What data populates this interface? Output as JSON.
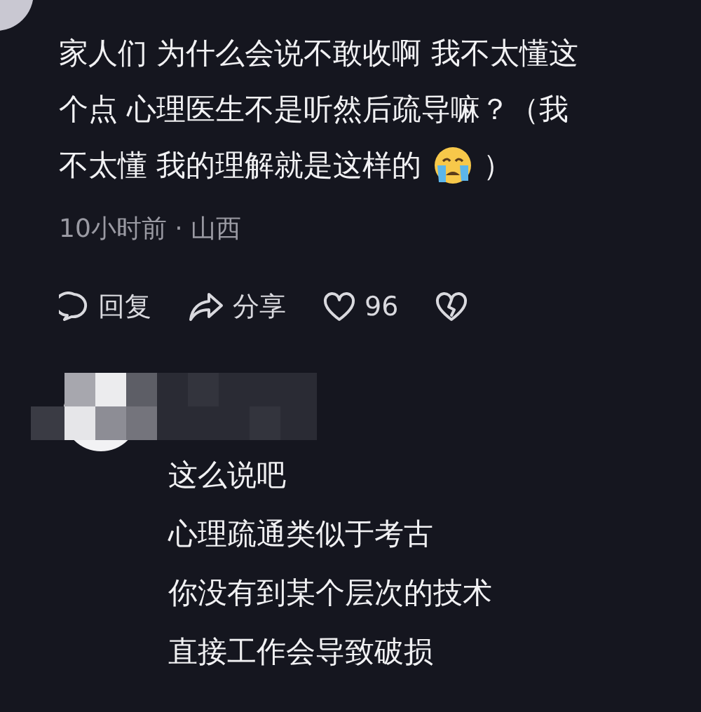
{
  "comment": {
    "lines": [
      "家人们 为什么会说不敢收啊 我不太懂这",
      "个点 心理医生不是听然后疏导嘛？（我",
      "不太懂 我的理解就是这样的"
    ],
    "closing": "）",
    "meta": "10小时前 · 山西",
    "actions": [
      {
        "kind": "reply",
        "label": "回复"
      },
      {
        "kind": "share",
        "label": "分享"
      },
      {
        "kind": "like",
        "label": "96"
      },
      {
        "kind": "dislike"
      }
    ]
  },
  "reply": {
    "lines": [
      "这么说吧",
      "心理疏通类似于考古",
      "你没有到某个层次的技术",
      "直接工作会导致破损"
    ]
  }
}
